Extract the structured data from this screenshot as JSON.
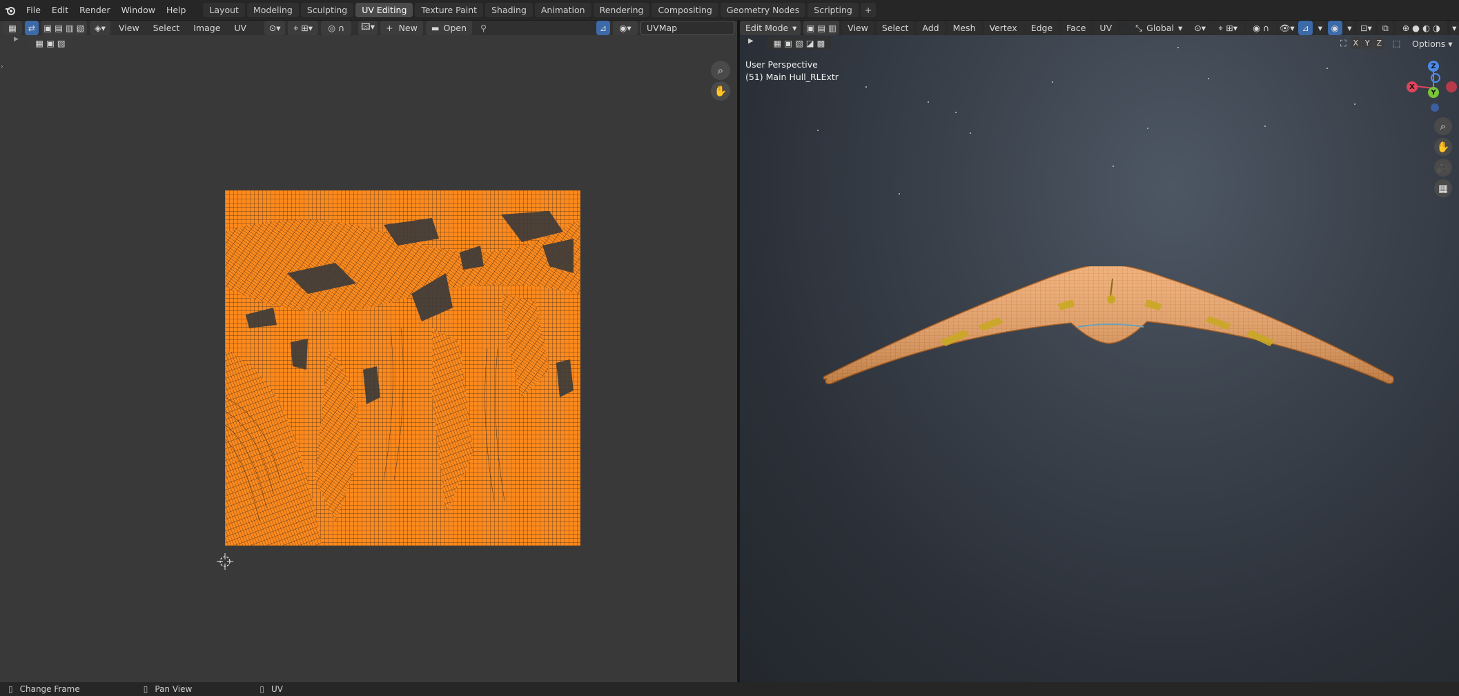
{
  "menu": [
    "File",
    "Edit",
    "Render",
    "Window",
    "Help"
  ],
  "workspace_tabs": [
    "Layout",
    "Modeling",
    "Sculpting",
    "UV Editing",
    "Texture Paint",
    "Shading",
    "Animation",
    "Rendering",
    "Compositing",
    "Geometry Nodes",
    "Scripting"
  ],
  "active_tab": "UV Editing",
  "uv_editor": {
    "menus": [
      "View",
      "Select",
      "Image",
      "UV"
    ],
    "new_label": "New",
    "open_label": "Open",
    "uvmap_value": "UVMap"
  },
  "viewport": {
    "mode": "Edit Mode",
    "menus": [
      "View",
      "Select",
      "Add",
      "Mesh",
      "Vertex",
      "Edge",
      "Face",
      "UV"
    ],
    "transform_orientation": "Global",
    "options_label": "Options",
    "axis_buttons": [
      "X",
      "Y",
      "Z"
    ],
    "perspective_label": "User Perspective",
    "object_label": "(51) Main Hull_RLExtr",
    "gizmo": {
      "x": "X",
      "y": "Y",
      "z": "Z"
    }
  },
  "status": {
    "left_label": "Change Frame",
    "middle_label": "Pan View",
    "right_label": "UV"
  },
  "colors": {
    "uv_wire": "#ff8a1c",
    "mesh": "#e89a3c",
    "accent": "#4772b3"
  }
}
